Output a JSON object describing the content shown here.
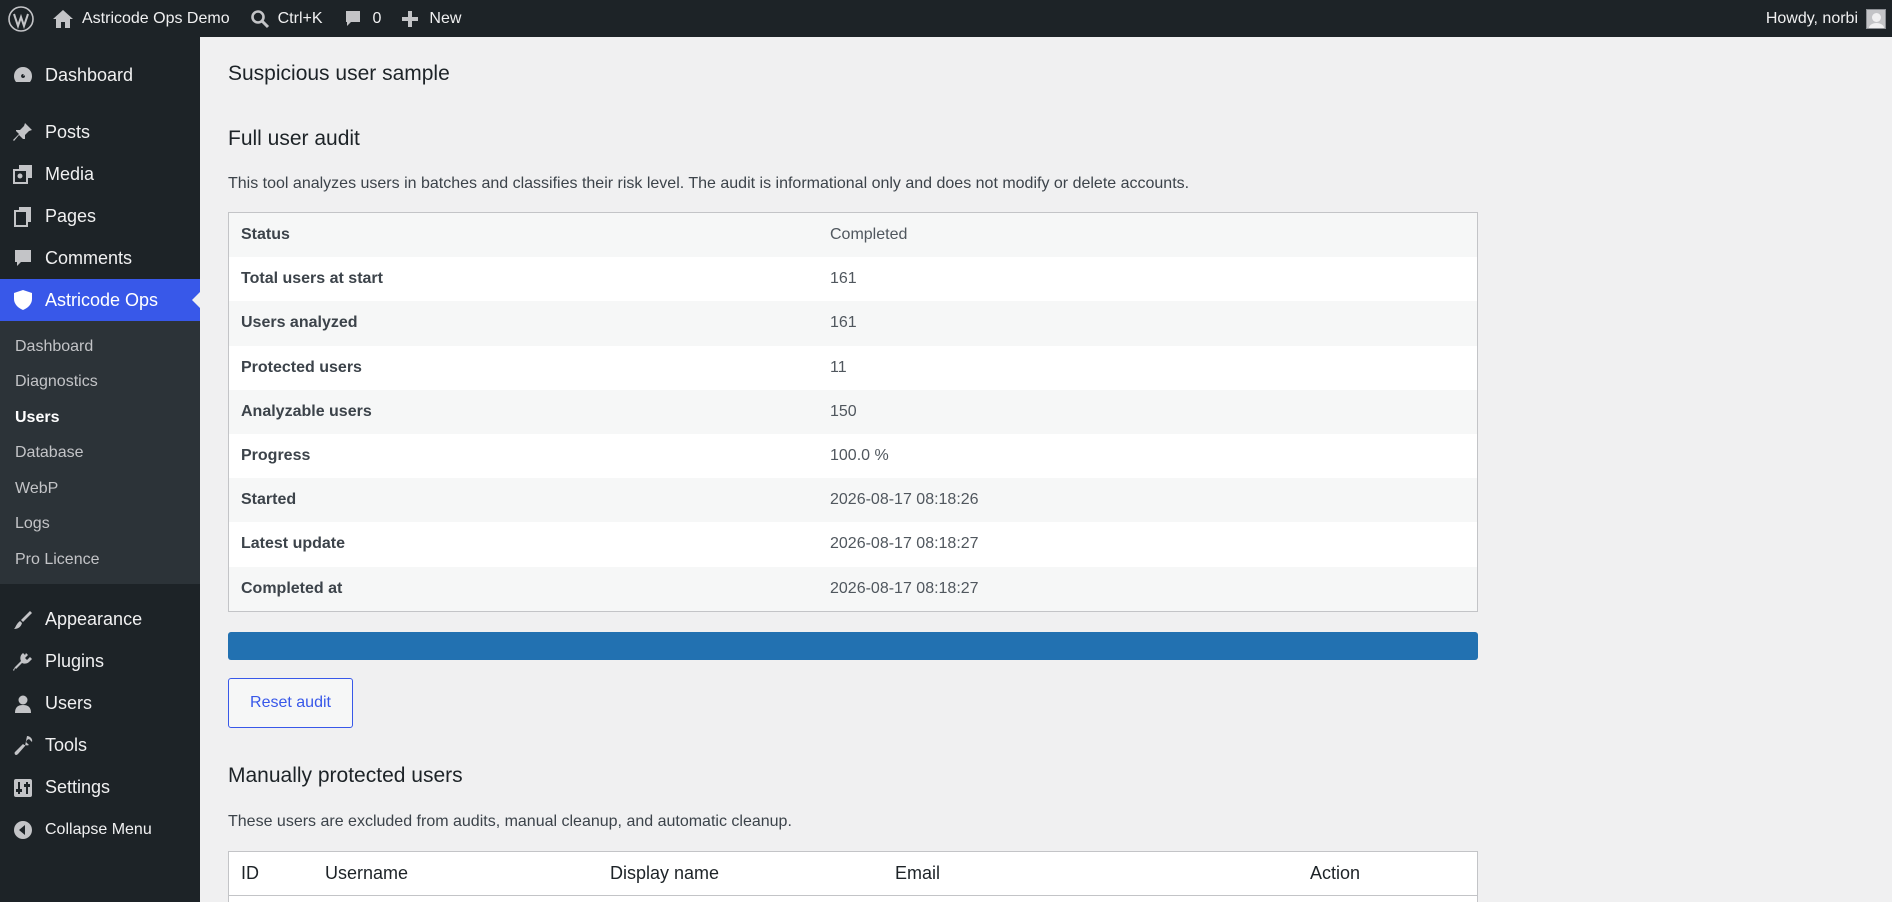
{
  "adminbar": {
    "site_name": "Astricode Ops Demo",
    "search_shortcut": "Ctrl+K",
    "comments_count": "0",
    "new_label": "New",
    "howdy": "Howdy, norbi"
  },
  "sidebar": {
    "items_top": [
      {
        "label": "Dashboard",
        "icon": "dashboard-icon"
      },
      {
        "label": "Posts",
        "icon": "pin-icon"
      },
      {
        "label": "Media",
        "icon": "media-icon"
      },
      {
        "label": "Pages",
        "icon": "pages-icon"
      },
      {
        "label": "Comments",
        "icon": "comment-icon"
      },
      {
        "label": "Astricode Ops",
        "icon": "shield-icon"
      }
    ],
    "submenu": [
      "Dashboard",
      "Diagnostics",
      "Users",
      "Database",
      "WebP",
      "Logs",
      "Pro Licence"
    ],
    "items_bottom": [
      {
        "label": "Appearance",
        "icon": "brush-icon"
      },
      {
        "label": "Plugins",
        "icon": "plug-icon"
      },
      {
        "label": "Users",
        "icon": "user-icon"
      },
      {
        "label": "Tools",
        "icon": "wrench-icon"
      },
      {
        "label": "Settings",
        "icon": "settings-icon"
      }
    ],
    "collapse_label": "Collapse Menu"
  },
  "main": {
    "page_heading": "Suspicious user sample",
    "audit_title": "Full user audit",
    "audit_description": "This tool analyzes users in batches and classifies their risk level. The audit is informational only and does not modify or delete accounts.",
    "status_rows": [
      {
        "key": "Status",
        "value": "Completed"
      },
      {
        "key": "Total users at start",
        "value": "161"
      },
      {
        "key": "Users analyzed",
        "value": "161"
      },
      {
        "key": "Protected users",
        "value": "11"
      },
      {
        "key": "Analyzable users",
        "value": "150"
      },
      {
        "key": "Progress",
        "value": "100.0 %"
      },
      {
        "key": "Started",
        "value": "2026-08-17 08:18:26"
      },
      {
        "key": "Latest update",
        "value": "2026-08-17 08:18:27"
      },
      {
        "key": "Completed at",
        "value": "2026-08-17 08:18:27"
      }
    ],
    "progress_fraction": 1.0,
    "reset_button": "Reset audit",
    "protected_title": "Manually protected users",
    "protected_description": "These users are excluded from audits, manual cleanup, and automatic cleanup.",
    "protected_table_headers": [
      "ID",
      "Username",
      "Display name",
      "Email",
      "Action"
    ]
  },
  "colors": {
    "adminbar_bg": "#1d2327",
    "accent": "#3858e9",
    "progress": "#2271b1"
  }
}
